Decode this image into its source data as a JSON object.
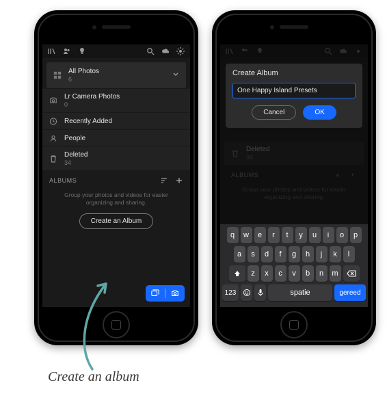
{
  "caption": "Create an album",
  "left": {
    "collections": [
      {
        "label": "All Photos",
        "count": "6"
      },
      {
        "label": "Lr Camera Photos",
        "count": "0"
      },
      {
        "label": "Recently Added",
        "count": ""
      },
      {
        "label": "People",
        "count": ""
      },
      {
        "label": "Deleted",
        "count": "34"
      }
    ],
    "albums_header": "ALBUMS",
    "empty_hint": "Group your photos and videos for easier organizing and sharing.",
    "create_button": "Create an Album"
  },
  "right": {
    "modal": {
      "title": "Create Album",
      "input_value": "One Happy Island Presets",
      "cancel": "Cancel",
      "ok": "OK"
    },
    "keyboard": {
      "r1": [
        "q",
        "w",
        "e",
        "r",
        "t",
        "y",
        "u",
        "i",
        "o",
        "p"
      ],
      "r2": [
        "a",
        "s",
        "d",
        "f",
        "g",
        "h",
        "j",
        "k",
        "l"
      ],
      "r3": [
        "z",
        "x",
        "c",
        "v",
        "b",
        "n",
        "m"
      ],
      "numbers": "123",
      "space": "spatie",
      "return": "gereed"
    }
  }
}
